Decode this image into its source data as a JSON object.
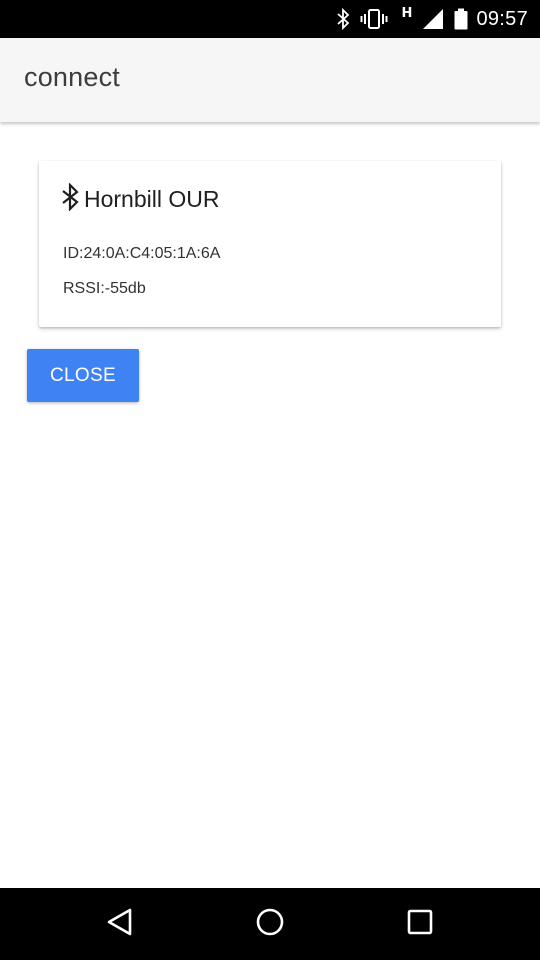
{
  "status_bar": {
    "icons": [
      "bluetooth-icon",
      "vibrate-icon",
      "network-type",
      "signal-icon",
      "battery-icon"
    ],
    "network_type": "H",
    "time": "09:57"
  },
  "app_bar": {
    "title": "connect",
    "background": "#f6f6f6"
  },
  "device": {
    "icon": "bluetooth-icon",
    "name": "Hornbill OUR",
    "id_text": "ID:24:0A:C4:05:1A:6A",
    "rssi_text": "RSSI:-55db"
  },
  "actions": {
    "close_label": "CLOSE",
    "close_color": "#3f82f4"
  },
  "nav_bar": {
    "buttons": [
      "back-icon",
      "home-icon",
      "recents-icon"
    ]
  }
}
